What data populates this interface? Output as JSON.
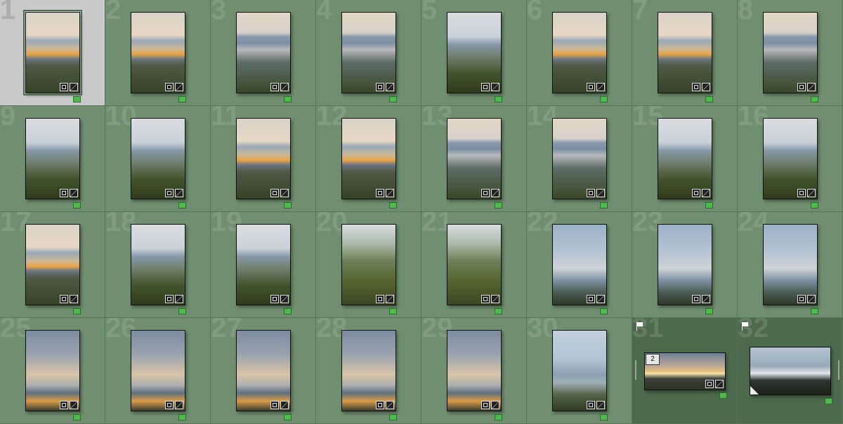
{
  "grid": {
    "cells": [
      {
        "n": "1",
        "tone": "sunset-lake"
      },
      {
        "n": "2",
        "tone": "sunset-lake"
      },
      {
        "n": "3",
        "tone": "hazy-island"
      },
      {
        "n": "4",
        "tone": "hazy-island"
      },
      {
        "n": "5",
        "tone": "lake-slope"
      },
      {
        "n": "6",
        "tone": "sunset-lake"
      },
      {
        "n": "7",
        "tone": "sunset-lake"
      },
      {
        "n": "8",
        "tone": "hazy-island"
      },
      {
        "n": "9",
        "tone": "lake-slope"
      },
      {
        "n": "10",
        "tone": "lake-slope"
      },
      {
        "n": "11",
        "tone": "sunset-lake"
      },
      {
        "n": "12",
        "tone": "sunset-lake"
      },
      {
        "n": "13",
        "tone": "hazy-island"
      },
      {
        "n": "14",
        "tone": "hazy-island"
      },
      {
        "n": "15",
        "tone": "lake-slope"
      },
      {
        "n": "16",
        "tone": "lake-slope"
      },
      {
        "n": "17",
        "tone": "sunset-lake"
      },
      {
        "n": "18",
        "tone": "lake-slope"
      },
      {
        "n": "19",
        "tone": "lake-slope"
      },
      {
        "n": "20",
        "tone": "green-slope"
      },
      {
        "n": "21",
        "tone": "green-slope"
      },
      {
        "n": "22",
        "tone": "blue-sky"
      },
      {
        "n": "23",
        "tone": "blue-sky"
      },
      {
        "n": "24",
        "tone": "blue-sky"
      },
      {
        "n": "25",
        "tone": "dusk-sky"
      },
      {
        "n": "26",
        "tone": "dusk-sky"
      },
      {
        "n": "27",
        "tone": "dusk-sky"
      },
      {
        "n": "28",
        "tone": "dusk-sky"
      },
      {
        "n": "29",
        "tone": "dusk-sky"
      },
      {
        "n": "30",
        "tone": "tree-lake"
      },
      {
        "n": "31",
        "tone": "panorama",
        "stack": "2"
      },
      {
        "n": "32",
        "tone": "panorama-dark"
      }
    ]
  },
  "colors": {
    "cell_bg": "#708e70",
    "selected_bg": "#c9c9c9",
    "flagged_bg": "#4e6a4e",
    "label_green": "#4fb84f"
  },
  "icons": {
    "crop": "crop-icon",
    "develop": "develop-settings-icon",
    "flag": "pick-flag-icon"
  }
}
